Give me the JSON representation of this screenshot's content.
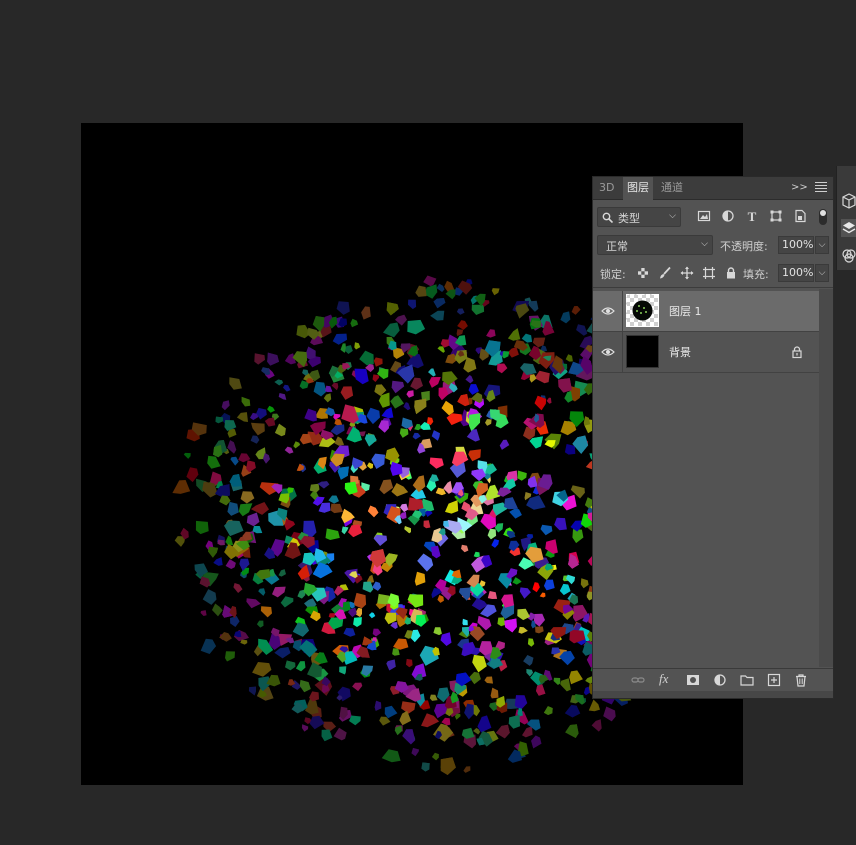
{
  "canvas": {
    "background": "#000000"
  },
  "layers_panel": {
    "tabs": [
      {
        "label": "3D",
        "active": false
      },
      {
        "label": "图层",
        "active": true
      },
      {
        "label": "通道",
        "active": false
      }
    ],
    "filter": {
      "kind_label": "类型"
    },
    "blend_mode": "正常",
    "opacity_label": "不透明度:",
    "opacity_value": "100%",
    "lock_label": "锁定:",
    "fill_label": "填充:",
    "fill_value": "100%",
    "layers": [
      {
        "name": "图层 1",
        "visible": true,
        "selected": true,
        "locked": false
      },
      {
        "name": "背景",
        "visible": true,
        "selected": false,
        "locked": true
      }
    ],
    "bottom_icons": [
      "link-icon",
      "fx-icon",
      "mask-icon",
      "adjustment-icon",
      "folder-icon",
      "new-layer-icon",
      "trash-icon"
    ],
    "fx_label": "fx"
  },
  "colors": {
    "app_bg": "#282828",
    "panel_bg": "#535353",
    "selected_row": "#6b6b6b"
  }
}
